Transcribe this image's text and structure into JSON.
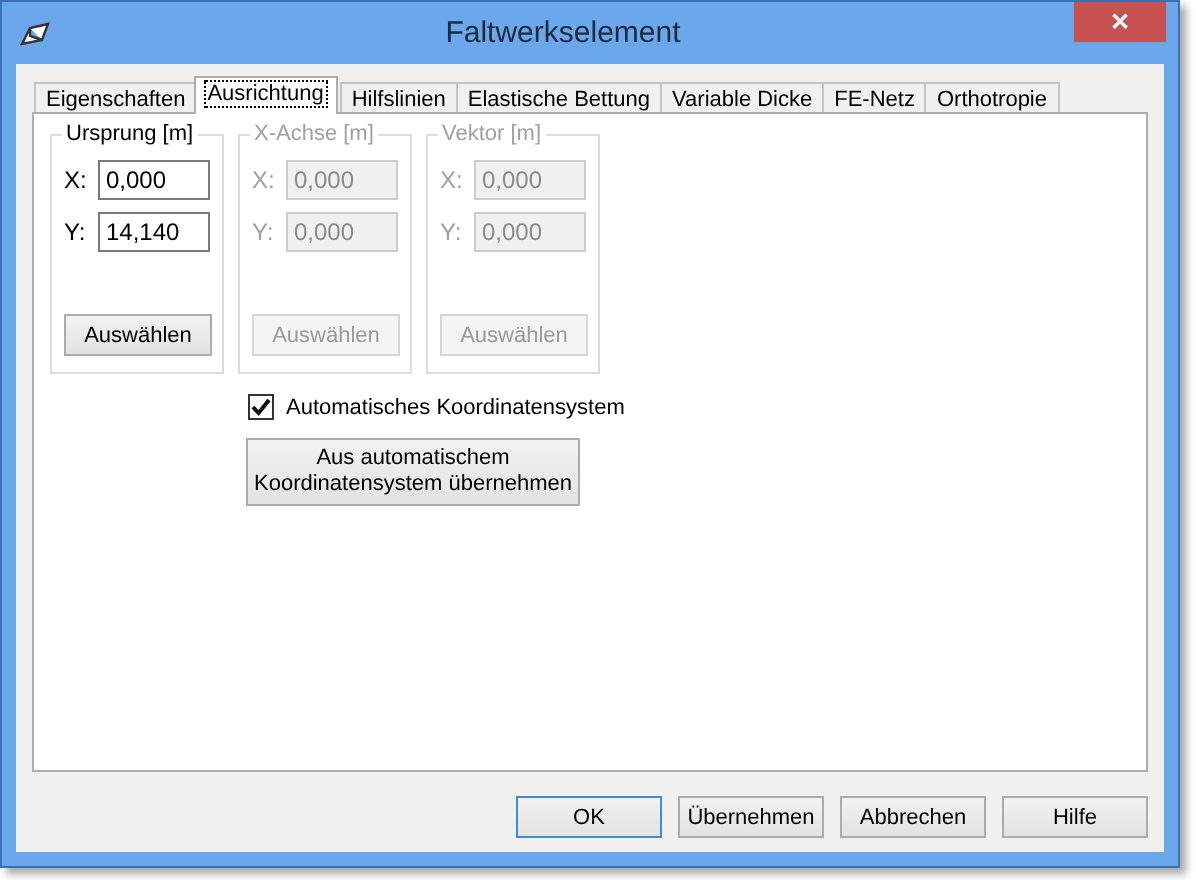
{
  "window": {
    "title": "Faltwerkselement",
    "close": "✕"
  },
  "tabs": [
    {
      "label": "Eigenschaften",
      "selected": false
    },
    {
      "label": "Ausrichtung",
      "selected": true
    },
    {
      "label": "Hilfslinien",
      "selected": false
    },
    {
      "label": "Elastische Bettung",
      "selected": false
    },
    {
      "label": "Variable Dicke",
      "selected": false
    },
    {
      "label": "FE-Netz",
      "selected": false
    },
    {
      "label": "Orthotropie",
      "selected": false
    }
  ],
  "groups": [
    {
      "title": "Ursprung [m]",
      "disabled": false,
      "fields": [
        {
          "label": "X:",
          "value": "0,000"
        },
        {
          "label": "Y:",
          "value": "14,140"
        }
      ],
      "button": "Auswählen"
    },
    {
      "title": "X-Achse [m]",
      "disabled": true,
      "fields": [
        {
          "label": "X:",
          "value": "0,000"
        },
        {
          "label": "Y:",
          "value": "0,000"
        }
      ],
      "button": "Auswählen"
    },
    {
      "title": "Vektor [m]",
      "disabled": true,
      "fields": [
        {
          "label": "X:",
          "value": "0,000"
        },
        {
          "label": "Y:",
          "value": "0,000"
        }
      ],
      "button": "Auswählen"
    }
  ],
  "checkbox": {
    "label": "Automatisches Koordinatensystem",
    "checked": true
  },
  "apply_button": "Aus automatischem Koordinatensystem übernehmen",
  "buttons": [
    {
      "label": "OK",
      "default": true
    },
    {
      "label": "Übernehmen",
      "default": false
    },
    {
      "label": "Abbrechen",
      "default": false
    },
    {
      "label": "Hilfe",
      "default": false
    }
  ]
}
